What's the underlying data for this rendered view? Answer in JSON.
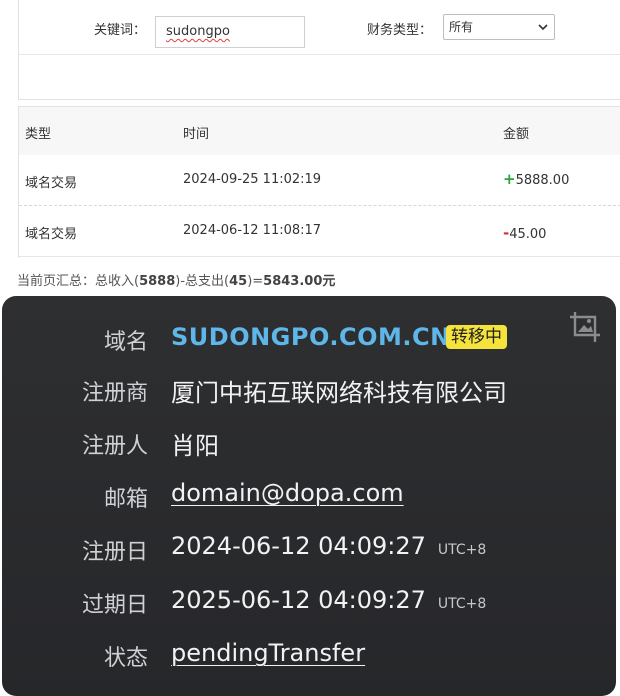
{
  "filter": {
    "keyword_label": "关键词：",
    "keyword_value": "sudongpo",
    "type_label": "财务类型：",
    "type_selected": "所有"
  },
  "table": {
    "headers": [
      "类型",
      "时间",
      "金额"
    ],
    "rows": [
      {
        "type": "域名交易",
        "time": "2024-09-25 11:02:19",
        "sign": "+",
        "amount": "5888.00"
      },
      {
        "type": "域名交易",
        "time": "2024-06-12 11:08:17",
        "sign": "-",
        "amount": "45.00"
      }
    ]
  },
  "summary": {
    "prefix": "当前页汇总：总收入(",
    "income": "5888",
    "mid": ")-总支出(",
    "expense": "45",
    "eq": ")=",
    "total": "5843.00元"
  },
  "whois": {
    "domain_label": "域名",
    "domain_value": "SUDONGPO.COM.CN",
    "badge": "转移中",
    "registrar_label": "注册商",
    "registrar_value": "厦门中拓互联网络科技有限公司",
    "registrant_label": "注册人",
    "registrant_value": "肖阳",
    "email_label": "邮箱",
    "email_value": "domain@dopa.com",
    "created_label": "注册日",
    "created_value": "2024-06-12 04:09:27",
    "created_tz": "UTC+8",
    "expires_label": "过期日",
    "expires_value": "2025-06-12 04:09:27",
    "expires_tz": "UTC+8",
    "status_label": "状态",
    "status_value": "pendingTransfer"
  },
  "colors": {
    "income_sign": "#2aa43a",
    "expense_sign": "#d3312b",
    "domain_accent": "#5fb6e8",
    "badge_bg": "#f5e33c",
    "card_bg": "#2b2c2f"
  },
  "icons": {
    "select_chevron": "chevron-down-icon",
    "card_corner": "crop-image-icon"
  }
}
